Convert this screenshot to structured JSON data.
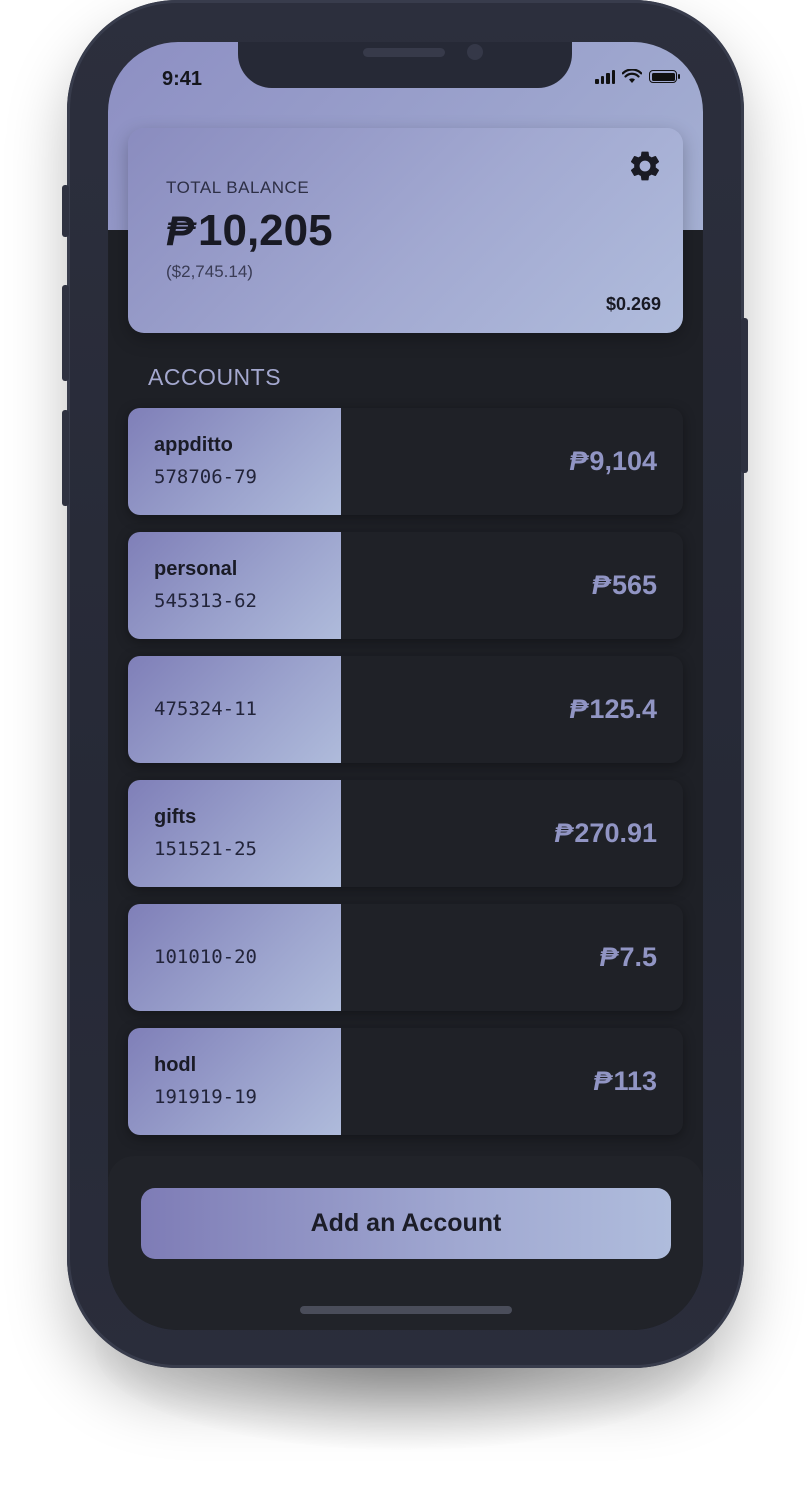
{
  "status_bar": {
    "time": "9:41"
  },
  "balance": {
    "label": "TOTAL BALANCE",
    "currency_symbol": "₱",
    "amount": "10,205",
    "usd_value": "($2,745.14)",
    "price": "$0.269"
  },
  "accounts_section": {
    "title": "ACCOUNTS"
  },
  "accounts": [
    {
      "name": "appditto",
      "id": "578706-79",
      "currency_symbol": "₱",
      "amount": "9,104"
    },
    {
      "name": "personal",
      "id": "545313-62",
      "currency_symbol": "₱",
      "amount": "565"
    },
    {
      "name": "",
      "id": "475324-11",
      "currency_symbol": "₱",
      "amount": "125.4"
    },
    {
      "name": "gifts",
      "id": "151521-25",
      "currency_symbol": "₱",
      "amount": "270.91"
    },
    {
      "name": "",
      "id": "101010-20",
      "currency_symbol": "₱",
      "amount": "7.5"
    },
    {
      "name": "hodl",
      "id": "191919-19",
      "currency_symbol": "₱",
      "amount": "113"
    }
  ],
  "actions": {
    "add_account_label": "Add an Account"
  },
  "colors": {
    "accent_gradient_start": "#7f7fb8",
    "accent_gradient_end": "#afbbdb",
    "background": "#1e2026",
    "amount_text": "#9195c4"
  },
  "icons": {
    "settings": "gear-icon",
    "signal": "signal-icon",
    "wifi": "wifi-icon",
    "battery": "battery-icon"
  }
}
